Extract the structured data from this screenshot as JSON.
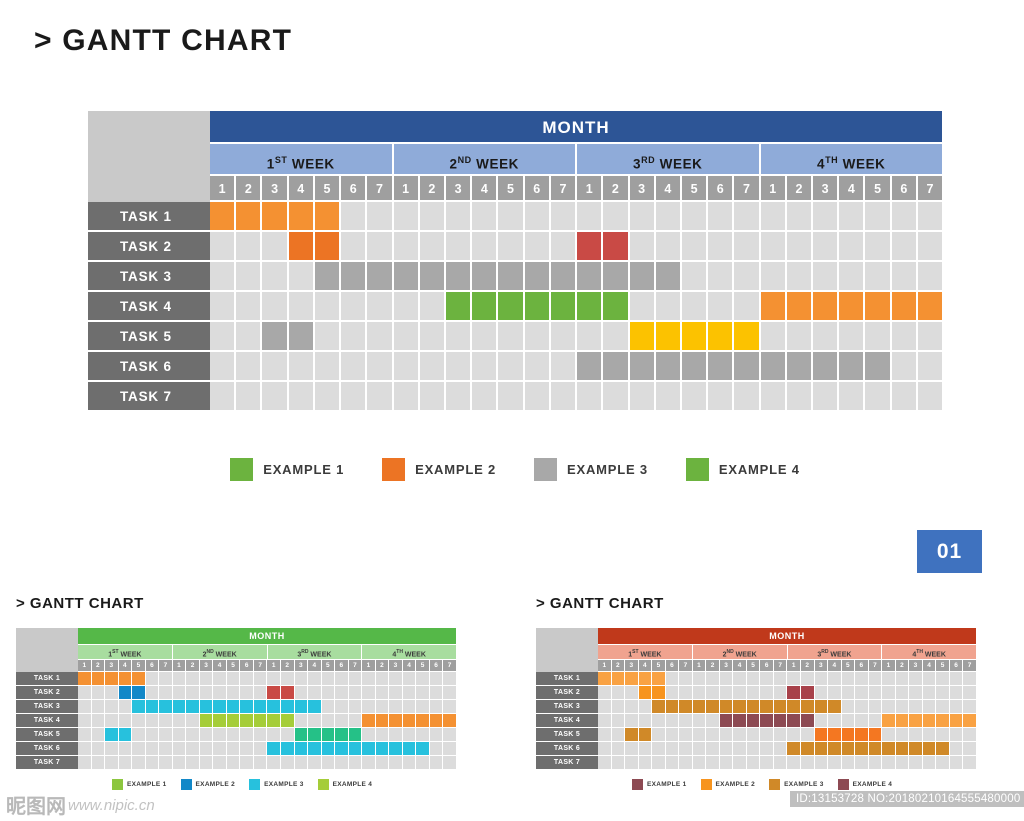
{
  "page": {
    "title": "> GANTT CHART",
    "badge": "01"
  },
  "colors": {
    "month_band": "#2d5596",
    "week_band": "#8fabd9",
    "day_band": "#9f9f9f",
    "task_label": "#6e6e6e",
    "empty_cell": "#dcdcdc",
    "corner": "#c9c9c9",
    "badge": "#3f72bf",
    "bar_green": "#6cb33f",
    "bar_orange_light": "#f49132",
    "bar_orange_dark": "#ec7424",
    "bar_gray": "#9f9f9f",
    "bar_red": "#c94a45",
    "bar_yellow": "#fcc200"
  },
  "main_chart": {
    "corner_label": "",
    "month_label": "MONTH",
    "weeks": [
      {
        "ordinal": "1",
        "suffix": "ST",
        "label": "1ST WEEK"
      },
      {
        "ordinal": "2",
        "suffix": "ND",
        "label": "2ND WEEK"
      },
      {
        "ordinal": "3",
        "suffix": "RD",
        "label": "3RD WEEK"
      },
      {
        "ordinal": "4",
        "suffix": "TH",
        "label": "4TH WEEK"
      }
    ],
    "days": [
      "1",
      "2",
      "3",
      "4",
      "5",
      "6",
      "7"
    ],
    "tasks": [
      {
        "label": "TASK 1"
      },
      {
        "label": "TASK 2"
      },
      {
        "label": "TASK 3"
      },
      {
        "label": "TASK 4"
      },
      {
        "label": "TASK 5"
      },
      {
        "label": "TASK 6"
      },
      {
        "label": "TASK 7"
      }
    ],
    "legend": [
      {
        "label": "EXAMPLE 1",
        "color": "#6cb33f"
      },
      {
        "label": "EXAMPLE 2",
        "color": "#ec7424"
      },
      {
        "label": "EXAMPLE 3",
        "color": "#a8a8a8"
      },
      {
        "label": "EXAMPLE 4",
        "color": "#6cb33f"
      }
    ]
  },
  "chart_data": {
    "type": "gantt",
    "title": "> GANTT CHART",
    "total_columns": 28,
    "week_count": 4,
    "days_per_week": 7,
    "categories": [
      "TASK 1",
      "TASK 2",
      "TASK 3",
      "TASK 4",
      "TASK 5",
      "TASK 6",
      "TASK 7"
    ],
    "charts": [
      {
        "name": "main",
        "theme": "blue",
        "bars": [
          {
            "task": "TASK 1",
            "start": 1,
            "end": 5,
            "color": "#f49132"
          },
          {
            "task": "TASK 2",
            "start": 4,
            "end": 5,
            "color": "#ec7424"
          },
          {
            "task": "TASK 2",
            "start": 15,
            "end": 16,
            "color": "#c94a45"
          },
          {
            "task": "TASK 3",
            "start": 5,
            "end": 18,
            "color": "#a8a8a8"
          },
          {
            "task": "TASK 4",
            "start": 10,
            "end": 16,
            "color": "#6cb33f"
          },
          {
            "task": "TASK 4",
            "start": 22,
            "end": 28,
            "color": "#f49132"
          },
          {
            "task": "TASK 5",
            "start": 3,
            "end": 4,
            "color": "#a8a8a8"
          },
          {
            "task": "TASK 5",
            "start": 17,
            "end": 21,
            "color": "#fcc200"
          },
          {
            "task": "TASK 6",
            "start": 15,
            "end": 26,
            "color": "#a8a8a8"
          },
          {
            "task": "TASK 7",
            "start": 0,
            "end": 0,
            "color": "none"
          }
        ]
      },
      {
        "name": "mini-left",
        "theme": "green",
        "bars": [
          {
            "task": "TASK 1",
            "start": 1,
            "end": 5,
            "color": "#f49132"
          },
          {
            "task": "TASK 2",
            "start": 4,
            "end": 5,
            "color": "#1288c8"
          },
          {
            "task": "TASK 2",
            "start": 15,
            "end": 16,
            "color": "#c94a45"
          },
          {
            "task": "TASK 3",
            "start": 5,
            "end": 18,
            "color": "#27c1dd"
          },
          {
            "task": "TASK 4",
            "start": 10,
            "end": 16,
            "color": "#a5cd39"
          },
          {
            "task": "TASK 4",
            "start": 22,
            "end": 28,
            "color": "#f49132"
          },
          {
            "task": "TASK 5",
            "start": 3,
            "end": 4,
            "color": "#27c1dd"
          },
          {
            "task": "TASK 5",
            "start": 17,
            "end": 21,
            "color": "#25c187"
          },
          {
            "task": "TASK 6",
            "start": 15,
            "end": 26,
            "color": "#27c1dd"
          },
          {
            "task": "TASK 7",
            "start": 0,
            "end": 0,
            "color": "none"
          }
        ]
      },
      {
        "name": "mini-right",
        "theme": "red",
        "bars": [
          {
            "task": "TASK 1",
            "start": 1,
            "end": 5,
            "color": "#f9a243"
          },
          {
            "task": "TASK 2",
            "start": 4,
            "end": 5,
            "color": "#f7941e"
          },
          {
            "task": "TASK 2",
            "start": 15,
            "end": 16,
            "color": "#a8414a"
          },
          {
            "task": "TASK 3",
            "start": 5,
            "end": 18,
            "color": "#d08928"
          },
          {
            "task": "TASK 4",
            "start": 10,
            "end": 16,
            "color": "#8d4a53"
          },
          {
            "task": "TASK 4",
            "start": 22,
            "end": 28,
            "color": "#f9a243"
          },
          {
            "task": "TASK 5",
            "start": 3,
            "end": 4,
            "color": "#d08928"
          },
          {
            "task": "TASK 5",
            "start": 17,
            "end": 21,
            "color": "#f47721"
          },
          {
            "task": "TASK 6",
            "start": 15,
            "end": 26,
            "color": "#d08928"
          },
          {
            "task": "TASK 7",
            "start": 0,
            "end": 0,
            "color": "none"
          }
        ]
      }
    ]
  },
  "mini_left": {
    "title": "> GANTT CHART",
    "month_label": "MONTH",
    "month_color": "#55b848",
    "week_color": "#a8dd9f",
    "weeks": [
      {
        "ordinal": "1",
        "suffix": "ST"
      },
      {
        "ordinal": "2",
        "suffix": "ND"
      },
      {
        "ordinal": "3",
        "suffix": "RD"
      },
      {
        "ordinal": "4",
        "suffix": "TH"
      }
    ],
    "days": [
      "1",
      "2",
      "3",
      "4",
      "5",
      "6",
      "7"
    ],
    "tasks": [
      "TASK 1",
      "TASK 2",
      "TASK 3",
      "TASK 4",
      "TASK 5",
      "TASK 6",
      "TASK 7"
    ],
    "legend": [
      {
        "label": "EXAMPLE 1",
        "color": "#8cc63f"
      },
      {
        "label": "EXAMPLE 2",
        "color": "#1288c8"
      },
      {
        "label": "EXAMPLE 3",
        "color": "#27c1dd"
      },
      {
        "label": "EXAMPLE 4",
        "color": "#a5cd39"
      }
    ]
  },
  "mini_right": {
    "title": "> GANTT CHART",
    "month_label": "MONTH",
    "month_color": "#c0391b",
    "week_color": "#f0a38f",
    "weeks": [
      {
        "ordinal": "1",
        "suffix": "ST"
      },
      {
        "ordinal": "2",
        "suffix": "ND"
      },
      {
        "ordinal": "3",
        "suffix": "RD"
      },
      {
        "ordinal": "4",
        "suffix": "TH"
      }
    ],
    "days": [
      "1",
      "2",
      "3",
      "4",
      "5",
      "6",
      "7"
    ],
    "tasks": [
      "TASK 1",
      "TASK 2",
      "TASK 3",
      "TASK 4",
      "TASK 5",
      "TASK 6",
      "TASK 7"
    ],
    "legend": [
      {
        "label": "EXAMPLE 1",
        "color": "#8d4a53"
      },
      {
        "label": "EXAMPLE 2",
        "color": "#f7941e"
      },
      {
        "label": "EXAMPLE 3",
        "color": "#d08928"
      },
      {
        "label": "EXAMPLE 4",
        "color": "#8d4a53"
      }
    ]
  },
  "watermark": {
    "logo": "昵图网",
    "url": "www.nipic.cn",
    "id_text": "ID:13153728 NO:20180210164555480000"
  }
}
